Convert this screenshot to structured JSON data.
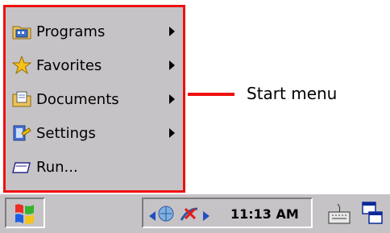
{
  "start_menu": {
    "items": [
      {
        "label": "Programs",
        "icon": "programs-folder-icon",
        "has_submenu": true
      },
      {
        "label": "Favorites",
        "icon": "star-icon",
        "has_submenu": true
      },
      {
        "label": "Documents",
        "icon": "documents-folder-icon",
        "has_submenu": true
      },
      {
        "label": "Settings",
        "icon": "settings-icon",
        "has_submenu": true
      },
      {
        "label": "Run...",
        "icon": "run-icon",
        "has_submenu": false
      }
    ],
    "callout_label": "Start menu"
  },
  "taskbar": {
    "start_icon": "windows-flag-icon",
    "tray": {
      "clock": "11:13 AM",
      "icons": [
        "network-icon",
        "disconnected-icon"
      ]
    },
    "keyboard_icon": "keyboard-icon",
    "switcher_icon": "window-switcher-icon"
  },
  "colors": {
    "highlight": "#ef1010",
    "panel": "#c6c3c6"
  }
}
